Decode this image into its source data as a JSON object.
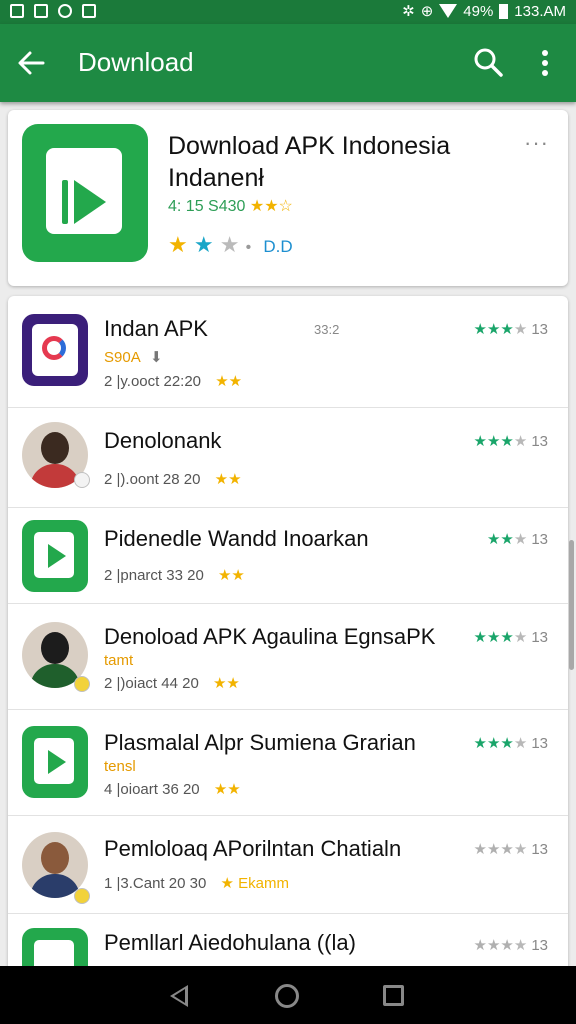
{
  "status_bar": {
    "battery": "49%",
    "time": "133.AM"
  },
  "app_bar": {
    "title": "Download"
  },
  "featured": {
    "title": "Download APK Indonesia Indanenł",
    "meta": "4: 15 S430",
    "meta_stars": "★★☆",
    "rating_stars": "★ ★ ★",
    "rating_dot": "•",
    "rating_label": "D.D",
    "menu": "···"
  },
  "apps": [
    {
      "name": "Indan APK",
      "mid": "33:2",
      "sub": "S90A",
      "sub_icon": "⬇",
      "meta": "2 |y.ooct 22:20",
      "meta_stars": "★★",
      "stars_on": "★★★",
      "stars_off": "★",
      "count": "13"
    },
    {
      "name": "Denolonank",
      "mid": "",
      "sub": "",
      "sub_icon": "",
      "meta": "2 |).oont 28 20",
      "meta_stars": "★★",
      "stars_on": "★★★",
      "stars_off": "★",
      "count": "13"
    },
    {
      "name": "Pidenedle Wandd Inoarkan",
      "mid": "",
      "sub": "",
      "sub_icon": "",
      "meta": "2 |pnarct 33 20",
      "meta_stars": "★★",
      "stars_on": "★★",
      "stars_off": "★",
      "count": "13"
    },
    {
      "name": "Denoload APK Agaulina EgnsaPK",
      "mid": "",
      "sub": "tamt",
      "sub_icon": "",
      "meta": "2 |)oiact 44 20",
      "meta_stars": "★★",
      "stars_on": "★★★",
      "stars_off": "★",
      "count": "13"
    },
    {
      "name": "Plasmalal Alpr Sumiena Grarian",
      "mid": "",
      "sub": "tensl",
      "sub_icon": "",
      "meta": "4 |oioart 36 20",
      "meta_stars": "★★",
      "stars_on": "★★★",
      "stars_off": "★",
      "count": "13"
    },
    {
      "name": "Pemloloaq APorilntan Chatialn",
      "mid": "",
      "sub": "",
      "sub_icon": "",
      "meta": "1 |3.Cant 20 30",
      "meta_stars": "★ Ekamm",
      "stars_on": "★★★",
      "stars_off": "★",
      "count": "13"
    },
    {
      "name": "Pemllarl Aiedohulana ((la)",
      "mid": "",
      "sub": "",
      "sub_icon": "",
      "meta": "",
      "meta_stars": "",
      "stars_on": "★★★",
      "stars_off": "★",
      "count": "13"
    }
  ]
}
